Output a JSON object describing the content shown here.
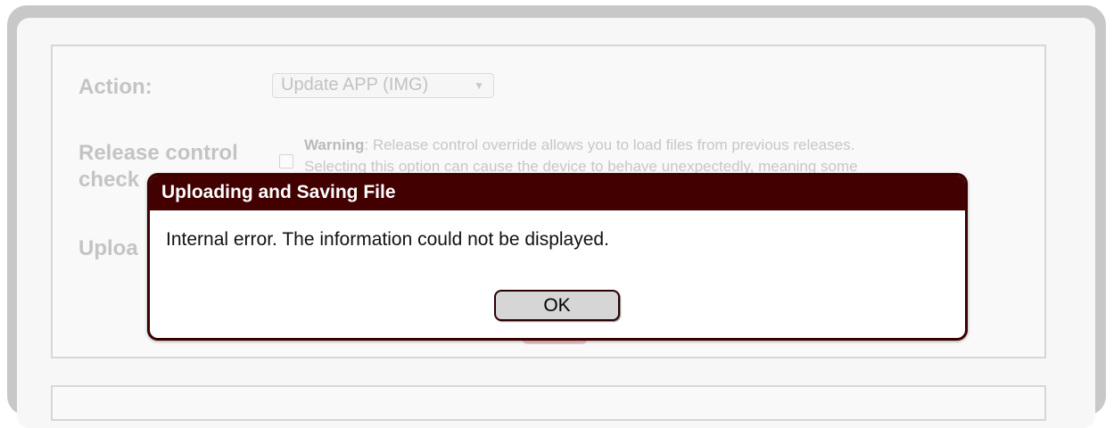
{
  "form": {
    "action_label": "Action:",
    "action_select_value": "Update APP (IMG)",
    "release_label_line1": "Release control",
    "release_label_line2": "check",
    "upload_label": "Uploa",
    "warning_bold": "Warning",
    "warning_line1": ": Release control override allows you to load files from previous releases.",
    "warning_line2": "Selecting this option can cause the device to behave unexpectedly, meaning some"
  },
  "dialog": {
    "title": "Uploading and Saving File",
    "message": "Internal error. The information could not be displayed.",
    "ok_label": "OK"
  },
  "colors": {
    "dialog_header": "#430000",
    "dialog_border": "#3a0000"
  },
  "icons": {
    "select_caret": "chevron-down-icon"
  }
}
